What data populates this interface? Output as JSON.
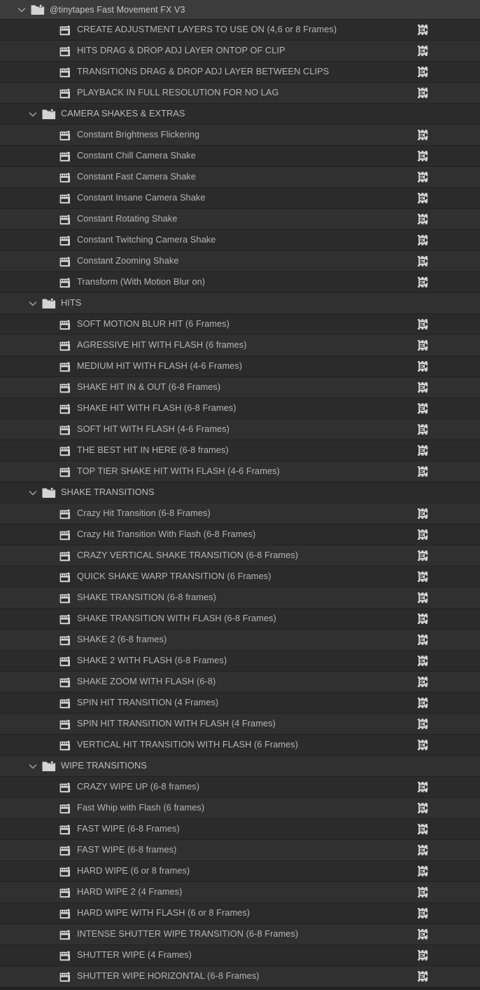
{
  "panel": {
    "title": "@tinytapes Fast Movement FX V3",
    "colors": {
      "header_bg": "#3c3c3c",
      "row_odd_bg": "#2b2b2b",
      "row_even_bg": "#303030",
      "row_divider": "#222222",
      "text": "#b6b6b6",
      "header_text": "#c8c8c8",
      "icon_fill": "#d4d4d4",
      "chevron": "#a0a0a0",
      "panel_bg": "#232323"
    },
    "icons": {
      "disclosure": "chevron-down-icon",
      "folder": "bin-folder-star-icon",
      "clip": "clip-film-star-icon",
      "sequence": "sequence-icon"
    }
  },
  "rows": [
    {
      "type": "header",
      "depth": 0,
      "expanded": true,
      "icon": "bin-folder-star-icon",
      "label": "@tinytapes Fast Movement FX V3",
      "sequence": false
    },
    {
      "type": "clip",
      "depth": 2,
      "icon": "clip-film-star-icon",
      "label": "CREATE ADJUSTMENT LAYERS TO USE ON (4,6 or 8 Frames)",
      "sequence": true
    },
    {
      "type": "clip",
      "depth": 2,
      "icon": "clip-film-star-icon",
      "label": "HITS DRAG & DROP ADJ LAYER ONTOP OF CLIP",
      "sequence": true
    },
    {
      "type": "clip",
      "depth": 2,
      "icon": "clip-film-star-icon",
      "label": "TRANSITIONS DRAG & DROP ADJ LAYER BETWEEN CLIPS",
      "sequence": true
    },
    {
      "type": "clip",
      "depth": 2,
      "icon": "clip-film-star-icon",
      "label": "PLAYBACK IN FULL RESOLUTION FOR NO LAG",
      "sequence": true
    },
    {
      "type": "folder",
      "depth": 1,
      "expanded": true,
      "icon": "bin-folder-star-icon",
      "label": "CAMERA SHAKES & EXTRAS",
      "sequence": false
    },
    {
      "type": "clip",
      "depth": 2,
      "icon": "clip-film-star-icon",
      "label": "Constant Brightness Flickering",
      "sequence": true
    },
    {
      "type": "clip",
      "depth": 2,
      "icon": "clip-film-star-icon",
      "label": "Constant Chill Camera Shake",
      "sequence": true
    },
    {
      "type": "clip",
      "depth": 2,
      "icon": "clip-film-star-icon",
      "label": "Constant Fast Camera Shake",
      "sequence": true
    },
    {
      "type": "clip",
      "depth": 2,
      "icon": "clip-film-star-icon",
      "label": "Constant Insane Camera Shake",
      "sequence": true
    },
    {
      "type": "clip",
      "depth": 2,
      "icon": "clip-film-star-icon",
      "label": "Constant Rotating Shake",
      "sequence": true
    },
    {
      "type": "clip",
      "depth": 2,
      "icon": "clip-film-star-icon",
      "label": "Constant Twitching Camera Shake",
      "sequence": true
    },
    {
      "type": "clip",
      "depth": 2,
      "icon": "clip-film-star-icon",
      "label": "Constant Zooming Shake",
      "sequence": true
    },
    {
      "type": "clip",
      "depth": 2,
      "icon": "clip-film-star-icon",
      "label": "Transform (With Motion Blur on)",
      "sequence": true
    },
    {
      "type": "folder",
      "depth": 1,
      "expanded": true,
      "icon": "bin-folder-star-icon",
      "label": "HITS",
      "sequence": false
    },
    {
      "type": "clip",
      "depth": 2,
      "icon": "clip-film-star-icon",
      "label": "SOFT MOTION BLUR HIT (6 Frames)",
      "sequence": true
    },
    {
      "type": "clip",
      "depth": 2,
      "icon": "clip-film-star-icon",
      "label": "AGRESSIVE HIT WITH FLASH (6 frames)",
      "sequence": true
    },
    {
      "type": "clip",
      "depth": 2,
      "icon": "clip-film-star-icon",
      "label": "MEDIUM HIT WITH FLASH (4-6 Frames)",
      "sequence": true
    },
    {
      "type": "clip",
      "depth": 2,
      "icon": "clip-film-star-icon",
      "label": "SHAKE HIT IN & OUT (6-8 Frames)",
      "sequence": true
    },
    {
      "type": "clip",
      "depth": 2,
      "icon": "clip-film-star-icon",
      "label": "SHAKE HIT WITH FLASH (6-8 Frames)",
      "sequence": true
    },
    {
      "type": "clip",
      "depth": 2,
      "icon": "clip-film-star-icon",
      "label": "SOFT HIT WITH FLASH (4-6 Frames)",
      "sequence": true
    },
    {
      "type": "clip",
      "depth": 2,
      "icon": "clip-film-star-icon",
      "label": "THE BEST HIT IN HERE (6-8 frames)",
      "sequence": true
    },
    {
      "type": "clip",
      "depth": 2,
      "icon": "clip-film-star-icon",
      "label": "TOP TIER SHAKE HIT WITH FLASH (4-6 Frames)",
      "sequence": true
    },
    {
      "type": "folder",
      "depth": 1,
      "expanded": true,
      "icon": "bin-folder-star-icon",
      "label": "SHAKE TRANSITIONS",
      "sequence": false
    },
    {
      "type": "clip",
      "depth": 2,
      "icon": "clip-film-star-icon",
      "label": "Crazy Hit Transition (6-8 Frames)",
      "sequence": true
    },
    {
      "type": "clip",
      "depth": 2,
      "icon": "clip-film-star-icon",
      "label": "Crazy Hit Transition With Flash (6-8 Frames)",
      "sequence": true
    },
    {
      "type": "clip",
      "depth": 2,
      "icon": "clip-film-star-icon",
      "label": "CRAZY VERTICAL SHAKE TRANSITION (6-8 Frames)",
      "sequence": true
    },
    {
      "type": "clip",
      "depth": 2,
      "icon": "clip-film-star-icon",
      "label": "QUICK SHAKE WARP TRANSITION (6 Frames)",
      "sequence": true
    },
    {
      "type": "clip",
      "depth": 2,
      "icon": "clip-film-star-icon",
      "label": "SHAKE TRANSITION (6-8 frames)",
      "sequence": true
    },
    {
      "type": "clip",
      "depth": 2,
      "icon": "clip-film-star-icon",
      "label": "SHAKE TRANSITION WITH FLASH (6-8 Frames)",
      "sequence": true
    },
    {
      "type": "clip",
      "depth": 2,
      "icon": "clip-film-star-icon",
      "label": "SHAKE 2 (6-8 frames)",
      "sequence": true
    },
    {
      "type": "clip",
      "depth": 2,
      "icon": "clip-film-star-icon",
      "label": "SHAKE 2 WITH FLASH (6-8 Frames)",
      "sequence": true
    },
    {
      "type": "clip",
      "depth": 2,
      "icon": "clip-film-star-icon",
      "label": "SHAKE ZOOM WITH FLASH (6-8)",
      "sequence": true
    },
    {
      "type": "clip",
      "depth": 2,
      "icon": "clip-film-star-icon",
      "label": "SPIN HIT TRANSITION (4 Frames)",
      "sequence": true
    },
    {
      "type": "clip",
      "depth": 2,
      "icon": "clip-film-star-icon",
      "label": "SPIN HIT TRANSITION WITH FLASH (4 Frames)",
      "sequence": true
    },
    {
      "type": "clip",
      "depth": 2,
      "icon": "clip-film-star-icon",
      "label": "VERTICAL HIT TRANSITION WITH FLASH (6 Frames)",
      "sequence": true
    },
    {
      "type": "folder",
      "depth": 1,
      "expanded": true,
      "icon": "bin-folder-star-icon",
      "label": "WIPE TRANSITIONS",
      "sequence": false
    },
    {
      "type": "clip",
      "depth": 2,
      "icon": "clip-film-star-icon",
      "label": "CRAZY WIPE UP (6-8 frames)",
      "sequence": true
    },
    {
      "type": "clip",
      "depth": 2,
      "icon": "clip-film-star-icon",
      "label": "Fast Whip with Flash (6 frames)",
      "sequence": true
    },
    {
      "type": "clip",
      "depth": 2,
      "icon": "clip-film-star-icon",
      "label": "FAST WIPE (6-8 Frames)",
      "sequence": true
    },
    {
      "type": "clip",
      "depth": 2,
      "icon": "clip-film-star-icon",
      "label": "FAST WIPE (6-8 frames)",
      "sequence": true
    },
    {
      "type": "clip",
      "depth": 2,
      "icon": "clip-film-star-icon",
      "label": "HARD WIPE (6 or 8 frames)",
      "sequence": true
    },
    {
      "type": "clip",
      "depth": 2,
      "icon": "clip-film-star-icon",
      "label": "HARD WIPE 2 (4 Frames)",
      "sequence": true
    },
    {
      "type": "clip",
      "depth": 2,
      "icon": "clip-film-star-icon",
      "label": "HARD WIPE WITH FLASH (6 or 8 Frames)",
      "sequence": true
    },
    {
      "type": "clip",
      "depth": 2,
      "icon": "clip-film-star-icon",
      "label": "INTENSE SHUTTER WIPE TRANSITION (6-8 Frames)",
      "sequence": true
    },
    {
      "type": "clip",
      "depth": 2,
      "icon": "clip-film-star-icon",
      "label": "SHUTTER WIPE (4 Frames)",
      "sequence": true
    },
    {
      "type": "clip",
      "depth": 2,
      "icon": "clip-film-star-icon",
      "label": "SHUTTER WIPE HORIZONTAL (6-8 Frames)",
      "sequence": true
    }
  ]
}
